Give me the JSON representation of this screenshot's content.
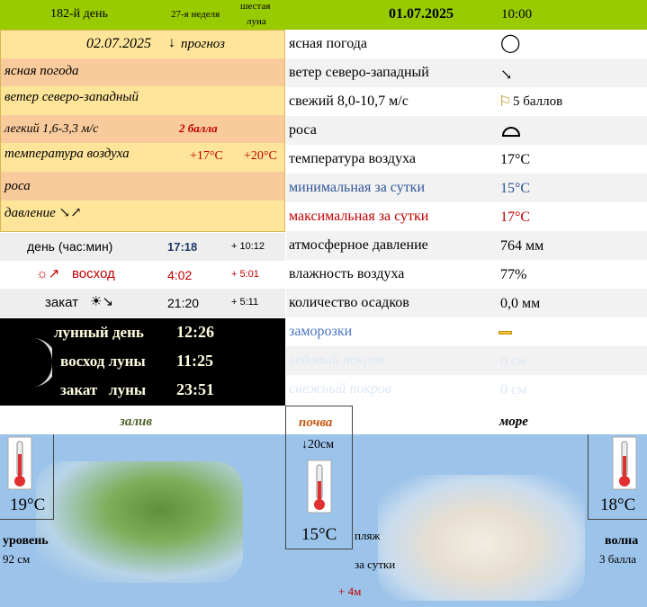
{
  "header": {
    "day_of_year": "182-й день",
    "week": "27-я неделя",
    "moon_phase_line1": "шестая",
    "moon_phase_line2": "луна",
    "date": "01.07.2025",
    "time": "10:00"
  },
  "forecast": {
    "date": "02.07.2025",
    "arrow": "↓",
    "label": "прогноз",
    "weather": "ясная погода",
    "wind": "ветер северо-западный",
    "wind_speed": "легкий 1,6-3,3 м/с",
    "wind_score": "2 балла",
    "temp_label": "температура воздуха",
    "temp_min": "+17°C",
    "temp_max": "+20°C",
    "dew": "роса",
    "pressure": "давление ↘↗"
  },
  "sun": {
    "daylen_label": "день (час:мин)",
    "daylen": "17:18",
    "daylen_delta": "+ 10:12",
    "sunrise_label": "восход",
    "sunrise": "4:02",
    "sunrise_delta": "+ 5:01",
    "sunset_label": "закат",
    "sunset": "21:20",
    "sunset_delta": "+ 5:11"
  },
  "moon": {
    "day_label": "лунный день",
    "day_value": "12:26",
    "rise_label": "восход луны",
    "rise_value": "11:25",
    "set_label": "закат   луны",
    "set_value": "23:51"
  },
  "current": {
    "rows": [
      {
        "label": "ясная погода",
        "value": "◯",
        "color": "#000000"
      },
      {
        "label": "ветер северо-западный",
        "value": "↘",
        "color": "#000000"
      },
      {
        "label": "свежий  8,0-10,7 м/с",
        "value": "5 баллов",
        "color": "#000000"
      },
      {
        "label": "роса",
        "value": "",
        "color": "#000000"
      },
      {
        "label": "температура воздуха",
        "value": "17°C",
        "color": "#000000"
      },
      {
        "label": "минимальная за сутки",
        "value": "15°C",
        "color": "#2f5597"
      },
      {
        "label": "максимальная за сутки",
        "value": "17°C",
        "color": "#c00000"
      },
      {
        "label": "атмосферное давление",
        "value": "764 мм",
        "color": "#000000"
      },
      {
        "label": "влажность воздуха",
        "value": "77%",
        "color": "#000000"
      },
      {
        "label": "количество осадков",
        "value": "0,0 мм",
        "color": "#000000"
      },
      {
        "label": "заморозки",
        "value": "",
        "color": "#4a76c0"
      },
      {
        "label": "ледовый покров",
        "value": "0 см",
        "color": "#dce8f8"
      },
      {
        "label": "снежный покров",
        "value": "0 см",
        "color": "#dce8f8"
      }
    ]
  },
  "bottom": {
    "bay_label": "залив",
    "soil_label": "почва",
    "sea_label": "море",
    "bay_temp": "19°C",
    "soil_depth": "↓20см",
    "soil_temp": "15°C",
    "sea_temp": "18°C",
    "level_label": "уровень",
    "level_value": "92 см",
    "beach_label": "пляж",
    "per_day_label": "за сутки",
    "beach_change": "+ 4м",
    "wave_label": "волна",
    "wave_value": "3 балла"
  },
  "colors": {
    "header": "#99cc00",
    "forecast_a": "#ffe599",
    "forecast_b": "#f9cb9c",
    "sky": "#9cc3ea"
  }
}
